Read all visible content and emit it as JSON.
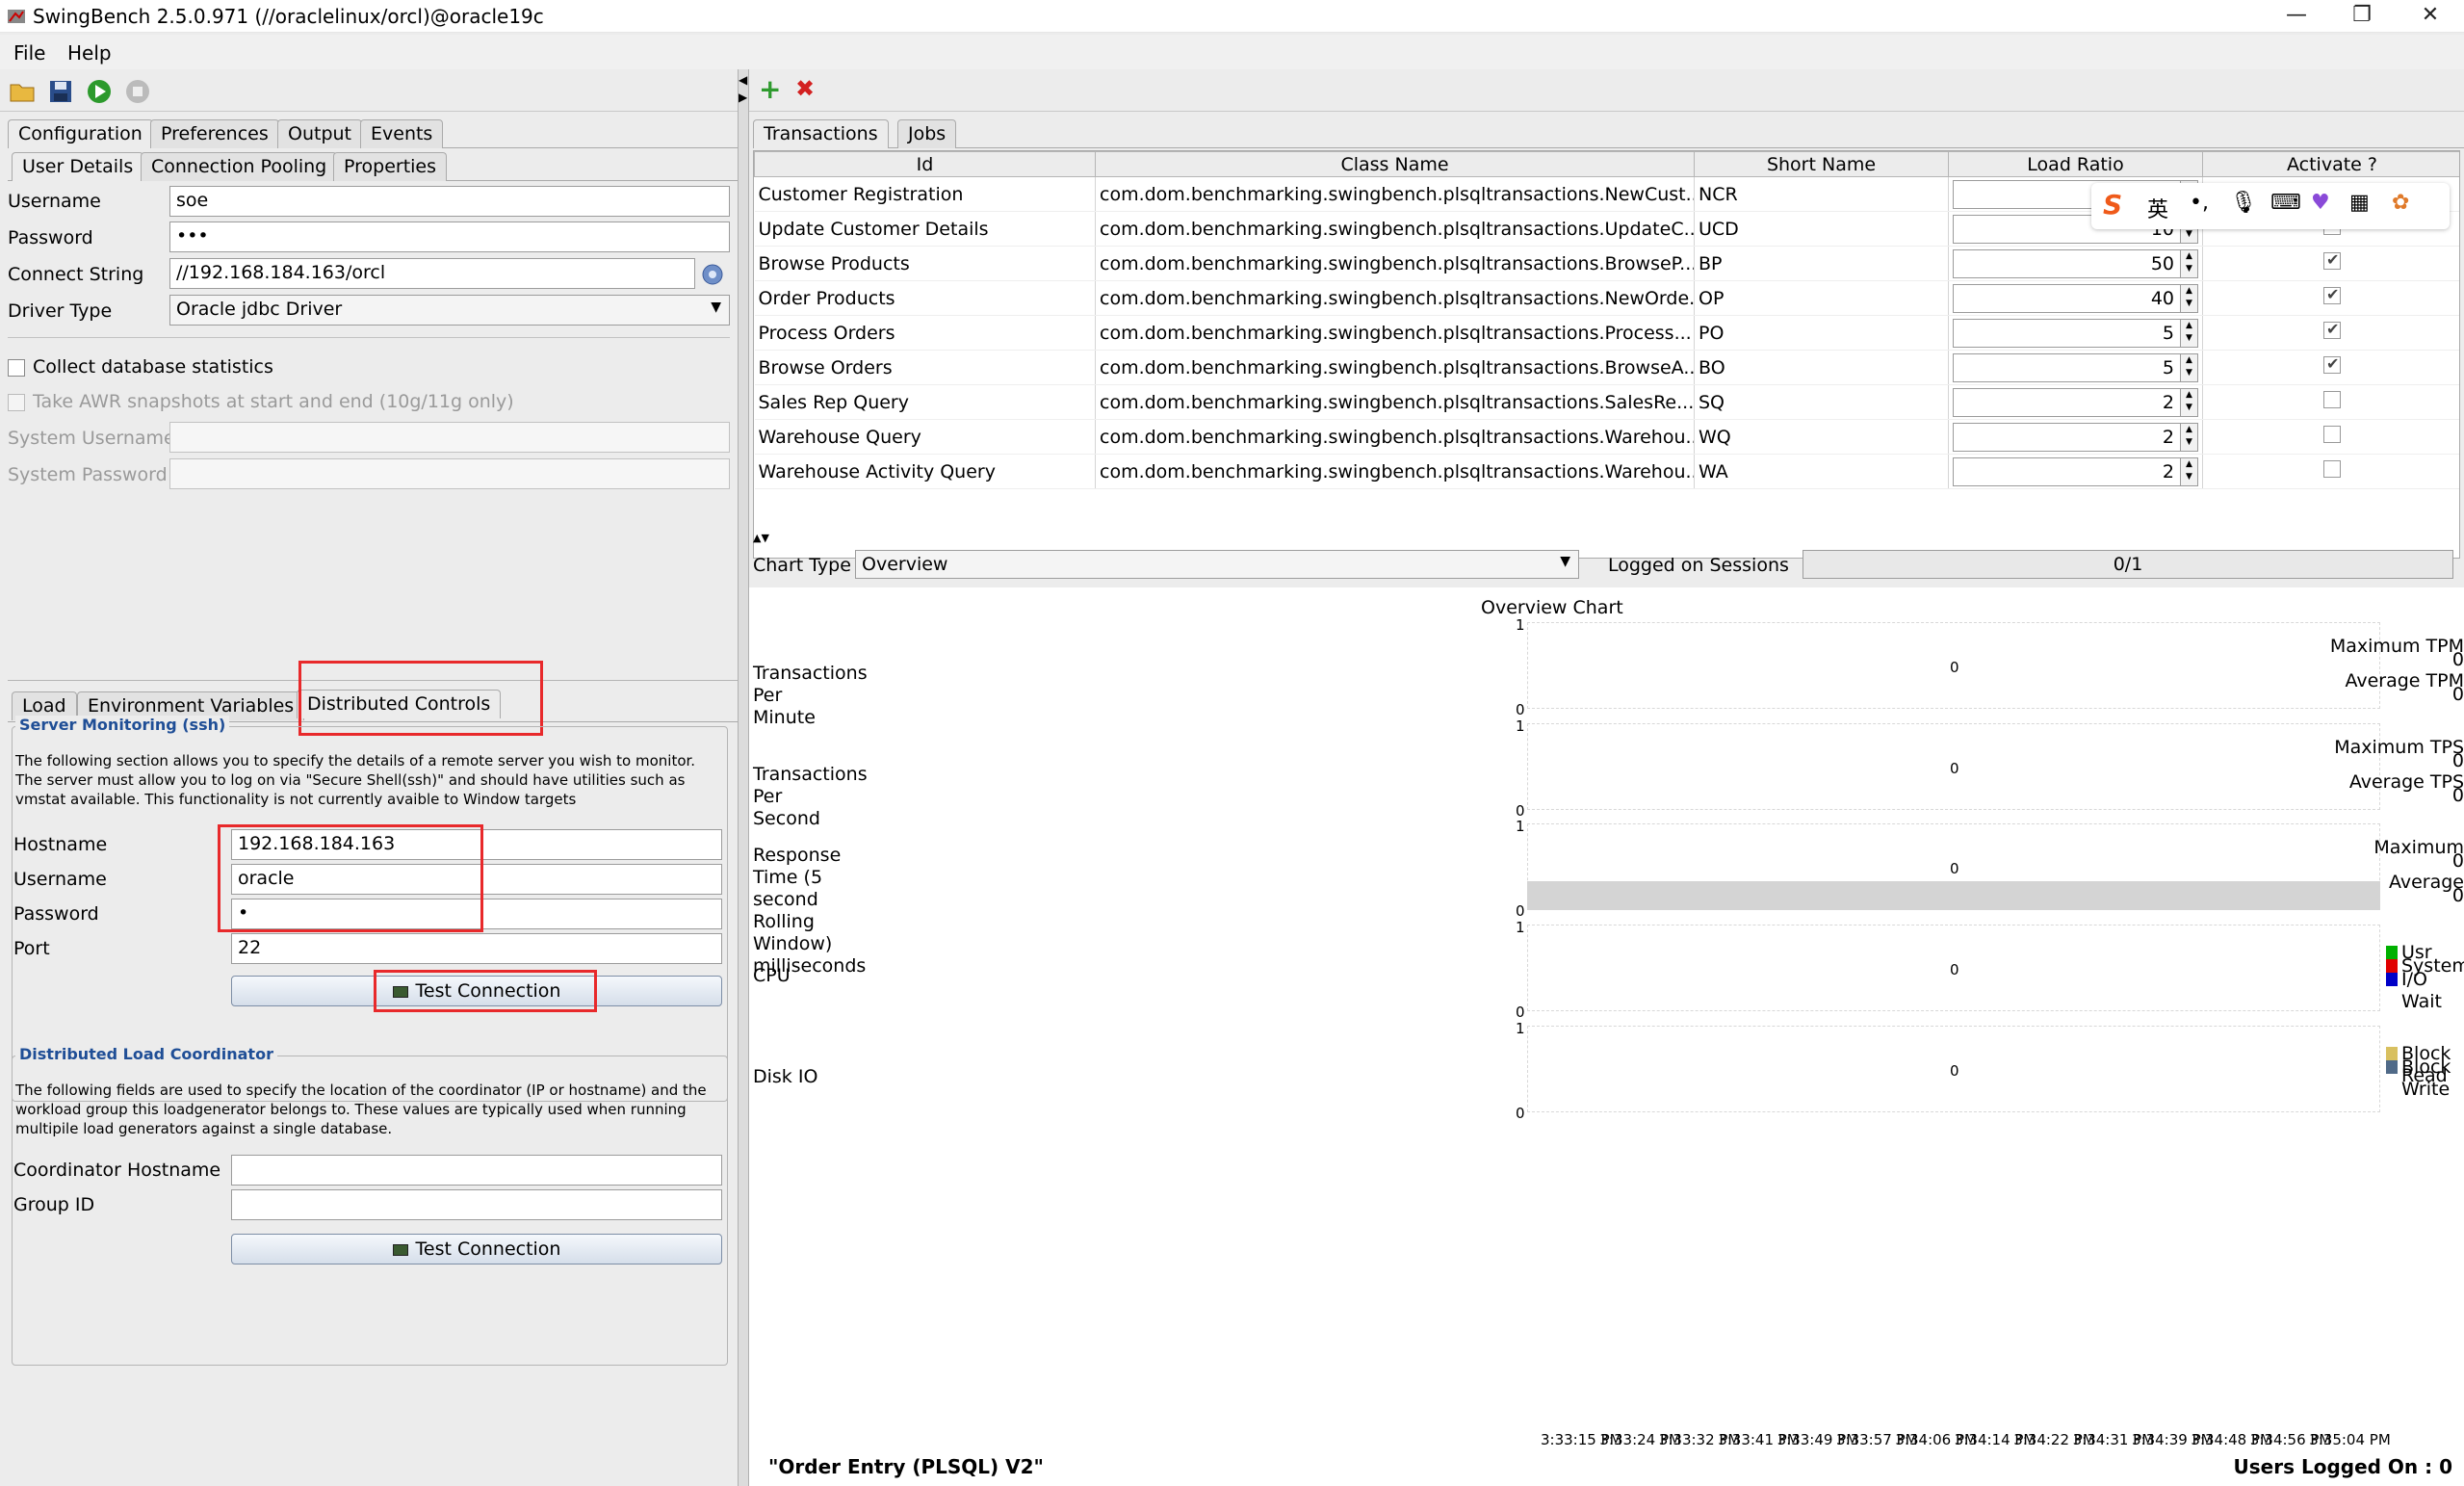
{
  "window": {
    "title": "SwingBench 2.5.0.971  (//oraclelinux/orcl)@oracle19c",
    "minimize": "—",
    "restore": "❐",
    "close": "✕"
  },
  "menu": {
    "file": "File",
    "help": "Help"
  },
  "left": {
    "tabs_top": [
      "Configuration",
      "Preferences",
      "Output",
      "Events"
    ],
    "tabs_sub": [
      "User Details",
      "Connection Pooling",
      "Properties"
    ],
    "user_details": {
      "username_label": "Username",
      "username_value": "soe",
      "password_label": "Password",
      "password_value": "•••",
      "connect_label": "Connect String",
      "connect_value": "//192.168.184.163/orcl",
      "driver_label": "Driver Type",
      "driver_value": "Oracle jdbc Driver",
      "collect_stats_label": "Collect database statistics",
      "awr_label": "Take AWR snapshots at start and end (10g/11g only)",
      "sys_user_label": "System Username",
      "sys_pass_label": "System Password"
    },
    "tabs_bottom": [
      "Load",
      "Environment Variables",
      "Distributed Controls"
    ],
    "server_monitoring": {
      "title": "Server Monitoring (ssh)",
      "description": "The following section allows you to specify the details of a remote server you wish to monitor. The server must allow you to log on via \"Secure Shell(ssh)\" and should have utilities such as vmstat available. This functionality is not currently avaible to Window targets",
      "hostname_label": "Hostname",
      "hostname_value": "192.168.184.163",
      "username_label": "Username",
      "username_value": "oracle",
      "password_label": "Password",
      "password_value": "•",
      "port_label": "Port",
      "port_value": "22",
      "test_button": "Test Connection"
    },
    "coordinator": {
      "title": "Distributed Load Coordinator",
      "description": "The following fields are used to specify the location of the coordinator (IP or hostname) and the workload group this loadgenerator belongs to. These values are typically used when running multipile load generators against a single database.",
      "host_label": "Coordinator Hostname",
      "host_value": "",
      "group_label": "Group ID",
      "group_value": "",
      "test_button": "Test Connection"
    }
  },
  "right": {
    "tabs": [
      "Transactions",
      "Jobs"
    ],
    "columns": [
      "Id",
      "Class Name",
      "Short Name",
      "Load Ratio",
      "Activate ?"
    ],
    "rows": [
      {
        "id": "Customer Registration",
        "cls": "com.dom.benchmarking.swingbench.plsqltransactions.NewCust...",
        "short": "NCR",
        "ratio": "",
        "active": true
      },
      {
        "id": "Update Customer Details",
        "cls": "com.dom.benchmarking.swingbench.plsqltransactions.UpdateC...",
        "short": "UCD",
        "ratio": "10",
        "active": true
      },
      {
        "id": "Browse Products",
        "cls": "com.dom.benchmarking.swingbench.plsqltransactions.BrowseP...",
        "short": "BP",
        "ratio": "50",
        "active": true
      },
      {
        "id": "Order Products",
        "cls": "com.dom.benchmarking.swingbench.plsqltransactions.NewOrde...",
        "short": "OP",
        "ratio": "40",
        "active": true
      },
      {
        "id": "Process Orders",
        "cls": "com.dom.benchmarking.swingbench.plsqltransactions.Process...",
        "short": "PO",
        "ratio": "5",
        "active": true
      },
      {
        "id": "Browse Orders",
        "cls": "com.dom.benchmarking.swingbench.plsqltransactions.BrowseA...",
        "short": "BO",
        "ratio": "5",
        "active": true
      },
      {
        "id": "Sales Rep Query",
        "cls": "com.dom.benchmarking.swingbench.plsqltransactions.SalesRe...",
        "short": "SQ",
        "ratio": "2",
        "active": false
      },
      {
        "id": "Warehouse Query",
        "cls": "com.dom.benchmarking.swingbench.plsqltransactions.Warehou...",
        "short": "WQ",
        "ratio": "2",
        "active": false
      },
      {
        "id": "Warehouse Activity Query",
        "cls": "com.dom.benchmarking.swingbench.plsqltransactions.Warehou...",
        "short": "WA",
        "ratio": "2",
        "active": false
      }
    ],
    "ime_bar": {
      "lang": "英"
    },
    "chart_type_label": "Chart Type",
    "chart_type_value": "Overview",
    "sessions_label": "Logged on Sessions",
    "sessions_value": "0/1"
  },
  "chart_data": {
    "type": "line",
    "title": "Overview Chart",
    "panels": [
      {
        "label": "Transactions Per Minute",
        "ymax": "1",
        "ymin": "0",
        "center": "0",
        "stats": [
          "Maximum TPM",
          "0",
          "Average TPM",
          "0"
        ]
      },
      {
        "label": "Transactions Per Second",
        "ymax": "1",
        "ymin": "0",
        "center": "0",
        "stats": [
          "Maximum TPS",
          "0",
          "Average TPS",
          "0"
        ]
      },
      {
        "label": "Response Time (5 second Rolling Window) milliseconds",
        "ymax": "1",
        "ymin": "0",
        "center": "0",
        "stats": [
          "Maximum",
          "0",
          "Average",
          "0"
        ]
      },
      {
        "label": "CPU",
        "ymax": "1",
        "ymin": "0",
        "center": "0",
        "legend": [
          {
            "name": "Usr",
            "color": "#00b000"
          },
          {
            "name": "System",
            "color": "#e00000"
          },
          {
            "name": "I/O Wait",
            "color": "#0000c8"
          }
        ]
      },
      {
        "label": "Disk IO",
        "ymax": "1",
        "ymin": "0",
        "center": "0",
        "legend": [
          {
            "name": "Block Read",
            "color": "#d8c060"
          },
          {
            "name": "Block Write",
            "color": "#506a88"
          }
        ]
      }
    ],
    "x_ticks": [
      "3:33:15 PM",
      "3:33:24 PM",
      "3:33:32 PM",
      "3:33:41 PM",
      "3:33:49 PM",
      "3:33:57 PM",
      "3:34:06 PM",
      "3:34:14 PM",
      "3:34:22 PM",
      "3:34:31 PM",
      "3:34:39 PM",
      "3:34:48 PM",
      "3:34:56 PM",
      "3:35:04 PM"
    ],
    "series": []
  },
  "status": {
    "benchmark": "\"Order Entry (PLSQL) V2\"",
    "users": "Users Logged On : 0"
  }
}
